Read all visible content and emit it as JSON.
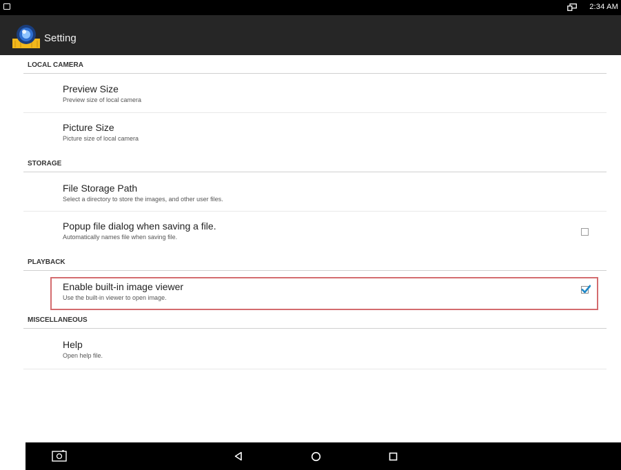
{
  "status_bar": {
    "time": "2:34 AM"
  },
  "action_bar": {
    "title": "Setting"
  },
  "categories": {
    "local_camera": "LOCAL CAMERA",
    "storage": "STORAGE",
    "playback": "PLAYBACK",
    "misc": "MISCELLANEOUS"
  },
  "prefs": {
    "preview_size": {
      "title": "Preview Size",
      "summary": "Preview size of local camera"
    },
    "picture_size": {
      "title": "Picture Size",
      "summary": "Picture size of local camera"
    },
    "file_storage_path": {
      "title": "File Storage Path",
      "summary": "Select a directory to store the images, and other user files."
    },
    "popup_file_dialog": {
      "title": "Popup file dialog when saving a file.",
      "summary": "Automatically names file when saving file.",
      "checked": false
    },
    "builtin_viewer": {
      "title": "Enable built-in image viewer",
      "summary": "Use the built-in viewer to open image.",
      "checked": true
    },
    "help": {
      "title": "Help",
      "summary": "Open help file."
    }
  },
  "icons": {
    "status_left": "notification-icon",
    "status_cast": "cast-icon",
    "app": "camera-app-icon",
    "nav_screenshot": "screenshot-icon",
    "nav_back": "back-icon",
    "nav_home": "home-icon",
    "nav_recents": "recents-icon"
  },
  "colors": {
    "action_bar": "#262626",
    "highlight_border": "#d36b6e",
    "checkbox_accent": "#1e88c8"
  }
}
